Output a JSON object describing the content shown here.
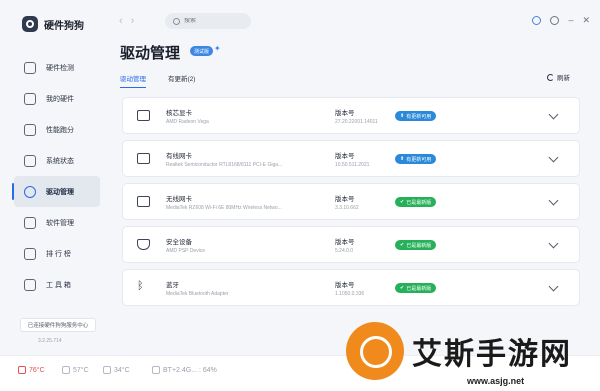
{
  "app": {
    "name": "硬件狗狗"
  },
  "sidebar": {
    "items": [
      {
        "label": "硬件检测",
        "active": false
      },
      {
        "label": "我的硬件",
        "active": false
      },
      {
        "label": "性能跑分",
        "active": false
      },
      {
        "label": "系统状态",
        "active": false
      },
      {
        "label": "驱动管理",
        "active": true
      },
      {
        "label": "软件管理",
        "active": false
      },
      {
        "label": "排 行 榜",
        "active": false
      },
      {
        "label": "工 具 箱",
        "active": false
      }
    ],
    "footer_button": "已连接硬件狗狗服务中心",
    "version": "3.2.25.714"
  },
  "topbar": {
    "search_placeholder": "搜索"
  },
  "page": {
    "title": "驱动管理",
    "badge": "测试版",
    "tabs": [
      {
        "label": "驱动管理",
        "active": true
      },
      {
        "label": "有更新(2)",
        "active": false
      }
    ],
    "refresh_label": "刷新"
  },
  "devices": [
    {
      "name": "核芯显卡",
      "sub": "AMD Radeon Vega",
      "version_label": "版本号",
      "version": "27.20.22001.14011",
      "status": "有更新可用",
      "status_type": "update",
      "icon": "display-card-icon"
    },
    {
      "name": "有线网卡",
      "sub": "Realtek Semiconductor RTL8168/8111 PCI-E Giga...",
      "version_label": "版本号",
      "version": "10.50.511.2021",
      "status": "有更新可用",
      "status_type": "update",
      "icon": "ethernet-icon"
    },
    {
      "name": "无线网卡",
      "sub": "MediaTek RZ608 Wi-Fi 6E 80MHz Wireless Netwo...",
      "version_label": "版本号",
      "version": "3.3.10.662",
      "status": "已是最新版",
      "status_type": "latest",
      "icon": "wifi-card-icon"
    },
    {
      "name": "安全设备",
      "sub": "AMD PSP Device",
      "version_label": "版本号",
      "version": "5.24.0.0",
      "status": "已是最新版",
      "status_type": "latest",
      "icon": "shield-icon"
    },
    {
      "name": "蓝牙",
      "sub": "MediaTek Bluetooth Adapter",
      "version_label": "版本号",
      "version": "1.1050.0.336",
      "status": "已是最新版",
      "status_type": "latest",
      "icon": "bluetooth-icon"
    }
  ],
  "statusbar": {
    "cpu_temp": "76°C",
    "gpu_temp": "57°C",
    "disk_temp": "34°C",
    "network": "BT+2.4G... : 64%"
  },
  "watermark": {
    "text": "艾斯手游网",
    "url": "www.asjg.net"
  }
}
